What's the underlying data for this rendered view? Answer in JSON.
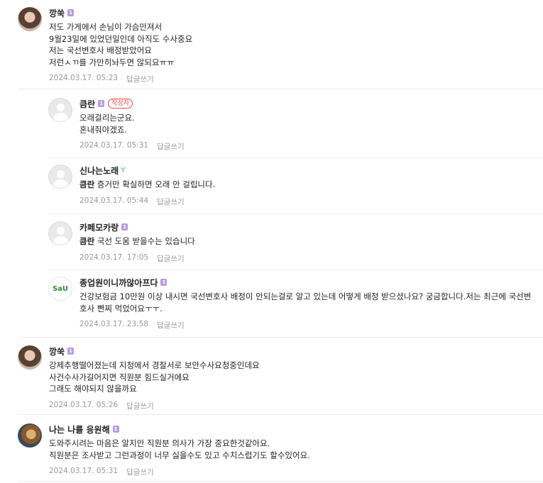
{
  "comments": [
    {
      "nick": "깡쑥",
      "level": "1",
      "text": "저도 가게에서 손님이 가슴만져서\n9월23일에 있었던일인데 아직도 수사중요\n저는 국선변호사 배정받았어요\n저런ㅅㄲ를 가만히놔두면 않되요ㅠㅠ",
      "date": "2024.03.17. 05:23",
      "reply": "답글쓰기"
    },
    {
      "nick": "큼란",
      "level": "1",
      "badge": "작성자",
      "text": "오래걸리는군요.\n혼내줘야겠죠.",
      "date": "2024.03.17. 05:31",
      "reply": "답글쓰기"
    },
    {
      "nick": "신나는노래",
      "mention": "큼란",
      "text": "증거만 확실하면 오래 안 걸립니다.",
      "date": "2024.03.17. 05:44",
      "reply": "답글쓰기"
    },
    {
      "nick": "카페모카랑",
      "level": "1",
      "mention": "큼란",
      "text": "국선 도움 받을수는 있습니다",
      "date": "2024.03.17. 17:05",
      "reply": "답글쓰기"
    },
    {
      "nick": "종업원이니까않아프다",
      "level": "1",
      "text": "건강보험금 10만원 이상 내시면 국선변호사 배정이 안되는걸로 알고 있는데 어떻게 배정 받으셨나요? 궁금합니다.저는 최근에 국선변호사 빤찌 먹었어요ㅜㅜ.",
      "date": "2024.03.17. 23:58",
      "reply": "답글쓰기"
    },
    {
      "nick": "깡쑥",
      "level": "1",
      "text": "강제추행떨어졌는데 지청에서 경찰서로 보안수사요청중인데요\n사건수사가길어지면 직원분 힘드실거에요\n그래도 해야되지 않을까요",
      "date": "2024.03.17. 05:26",
      "reply": "답글쓰기"
    },
    {
      "nick": "나는 나를 응원해",
      "level": "1",
      "text": "도와주시려는 마음은 알지만 직원분 의사가 가장 중요한것같아요.\n직원분은 조사받고 그런과정이 너무 싫을수도 있고 수치스럽기도 할수있어요.",
      "date": "2024.03.17. 05:31",
      "reply": "답글쓰기"
    }
  ],
  "avatar_logo_text": "SaU",
  "sprout_glyph": "Y"
}
